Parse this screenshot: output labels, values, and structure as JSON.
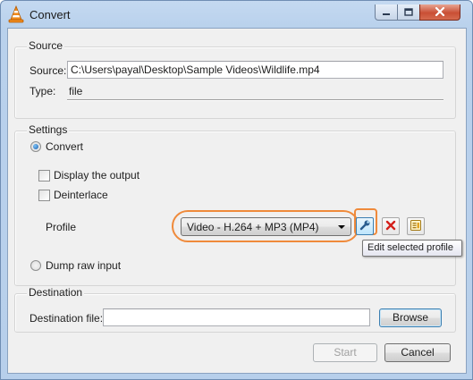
{
  "window": {
    "title": "Convert"
  },
  "source": {
    "group_label": "Source",
    "source_label": "Source:",
    "source_value": "C:\\Users\\payal\\Desktop\\Sample Videos\\Wildlife.mp4",
    "type_label": "Type:",
    "type_value": "file"
  },
  "settings": {
    "group_label": "Settings",
    "convert_label": "Convert",
    "convert_selected": true,
    "display_output_label": "Display the output",
    "display_output_checked": false,
    "deinterlace_label": "Deinterlace",
    "deinterlace_checked": false,
    "profile_label": "Profile",
    "profile_selected": "Video - H.264 + MP3 (MP4)",
    "tooltip": "Edit selected profile",
    "dump_raw_label": "Dump raw input",
    "dump_raw_selected": false
  },
  "destination": {
    "group_label": "Destination",
    "file_label": "Destination file:",
    "file_value": "",
    "browse_label": "Browse"
  },
  "footer": {
    "start_label": "Start",
    "cancel_label": "Cancel"
  },
  "colors": {
    "highlight": "#ef8a3b",
    "titlebar": "#b9d1ec"
  }
}
